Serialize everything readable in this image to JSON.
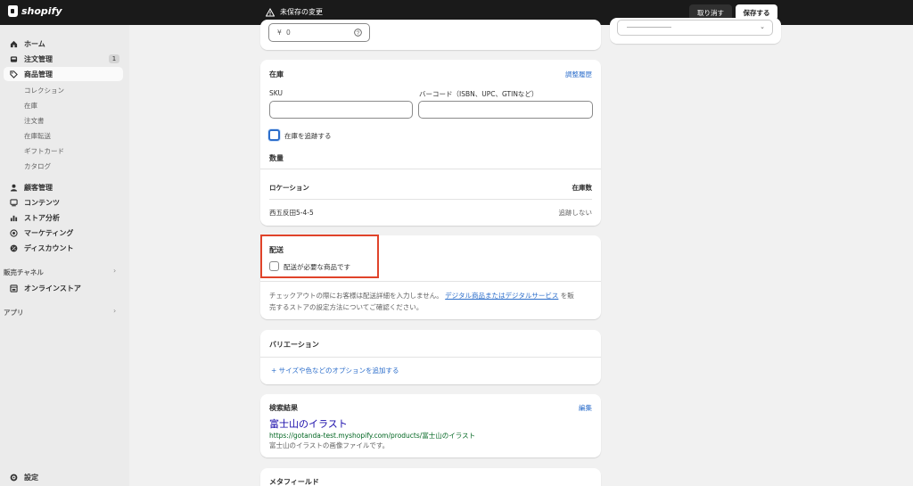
{
  "topbar": {
    "brand": "shopify",
    "unsaved": "未保存の変更",
    "discard": "取り消す",
    "save": "保存する"
  },
  "sidebar": {
    "items": [
      {
        "label": "ホーム",
        "icon": "home-icon"
      },
      {
        "label": "注文管理",
        "icon": "inbox-icon",
        "badge": "1"
      },
      {
        "label": "商品管理",
        "icon": "tag-icon",
        "active": true
      }
    ],
    "product_sub": [
      "コレクション",
      "在庫",
      "注文書",
      "在庫転送",
      "ギフトカード",
      "カタログ"
    ],
    "items2": [
      {
        "label": "顧客管理",
        "icon": "person-icon"
      },
      {
        "label": "コンテンツ",
        "icon": "content-icon"
      },
      {
        "label": "ストア分析",
        "icon": "chart-icon"
      },
      {
        "label": "マーケティング",
        "icon": "target-icon"
      },
      {
        "label": "ディスカウント",
        "icon": "discount-icon"
      }
    ],
    "sales_channels": "販売チャネル",
    "online_store": "オンラインストア",
    "apps": "アプリ",
    "settings": "設定"
  },
  "price": {
    "currency": "¥",
    "value": "0"
  },
  "inventory": {
    "title": "在庫",
    "adjust_link": "調整履歴",
    "sku_label": "SKU",
    "barcode_label": "バーコード（ISBN、UPC、GTINなど）",
    "track_label": "在庫を追跡する",
    "quantity_label": "数量",
    "col_location": "ロケーション",
    "col_stock": "在庫数",
    "location": "西五反田5-4-5",
    "stock_value": "追跡しない"
  },
  "shipping": {
    "title": "配送",
    "physical_label": "配送が必要な商品です",
    "note_before": "チェックアウトの際にお客様は配送詳細を入力しません。",
    "note_link": "デジタル商品またはデジタルサービス",
    "note_after": "を販",
    "note_line2": "売するストアの設定方法についてご確認ください。"
  },
  "variants": {
    "title": "バリエーション",
    "add": "+ サイズや色などのオプションを追加する"
  },
  "seo": {
    "title": "検索結果",
    "edit": "編集",
    "page_title": "富士山のイラスト",
    "url": "https://gotanda-test.myshopify.com/products/富士山のイラスト",
    "description": "富士山のイラストの画像ファイルです。"
  },
  "metafields": {
    "title": "メタフィールド"
  },
  "colors": {
    "accent": "#2c6ecb",
    "highlight": "#e0432a",
    "topbar": "#1a1a1a",
    "seo_title": "#1a0dab",
    "seo_url": "#006621"
  }
}
